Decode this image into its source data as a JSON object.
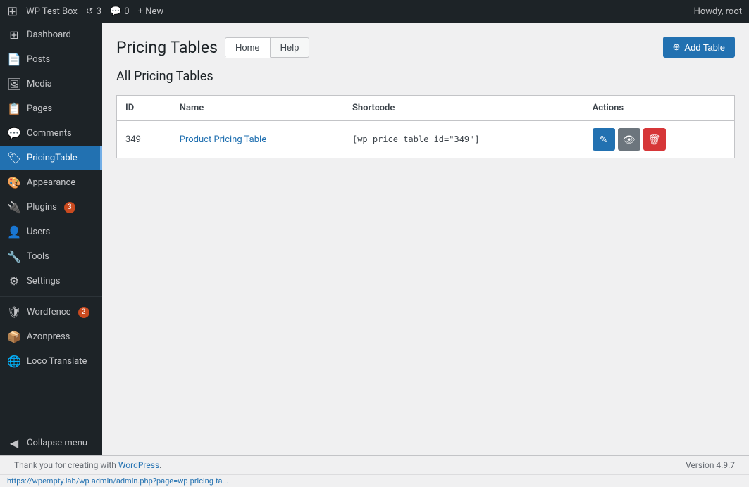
{
  "admin_bar": {
    "wp_logo": "⊞",
    "site_name": "WP Test Box",
    "revisions_icon": "↺",
    "revisions_count": "3",
    "comments_icon": "💬",
    "comments_count": "0",
    "new_label": "+ New",
    "howdy": "Howdy, root"
  },
  "sidebar": {
    "items": [
      {
        "id": "dashboard",
        "label": "Dashboard",
        "icon": "⊞"
      },
      {
        "id": "posts",
        "label": "Posts",
        "icon": "📄"
      },
      {
        "id": "media",
        "label": "Media",
        "icon": "🖼"
      },
      {
        "id": "pages",
        "label": "Pages",
        "icon": "📋"
      },
      {
        "id": "comments",
        "label": "Comments",
        "icon": "💬"
      },
      {
        "id": "pricingtable",
        "label": "PricingTable",
        "icon": "🏷",
        "active": true
      },
      {
        "id": "appearance",
        "label": "Appearance",
        "icon": "🎨"
      },
      {
        "id": "plugins",
        "label": "Plugins",
        "icon": "🔌",
        "badge": "3"
      },
      {
        "id": "users",
        "label": "Users",
        "icon": "👤"
      },
      {
        "id": "tools",
        "label": "Tools",
        "icon": "🔧"
      },
      {
        "id": "settings",
        "label": "Settings",
        "icon": "⚙"
      },
      {
        "id": "wordfence",
        "label": "Wordfence",
        "icon": "🛡",
        "badge": "2"
      },
      {
        "id": "azonpress",
        "label": "Azonpress",
        "icon": "📦"
      },
      {
        "id": "loco-translate",
        "label": "Loco Translate",
        "icon": "🌐"
      }
    ],
    "collapse_label": "Collapse menu"
  },
  "page": {
    "title": "Pricing Tables",
    "tabs": [
      {
        "id": "home",
        "label": "Home",
        "active": true
      },
      {
        "id": "help",
        "label": "Help",
        "active": false
      }
    ],
    "add_table_label": "Add Table",
    "section_title": "All Pricing Tables"
  },
  "table": {
    "columns": [
      "ID",
      "Name",
      "Shortcode",
      "Actions"
    ],
    "rows": [
      {
        "id": "349",
        "name": "Product Pricing Table",
        "shortcode": "[wp_price_table id=\"349\"]",
        "actions": [
          "edit",
          "preview",
          "delete"
        ]
      }
    ]
  },
  "footer": {
    "thank_you_text": "Thank you for creating with ",
    "wp_link": "WordPress",
    "version": "Version 4.9.7"
  },
  "url_bar": "https://wpempty.lab/wp-admin/admin.php?page=wp-pricing-ta..."
}
